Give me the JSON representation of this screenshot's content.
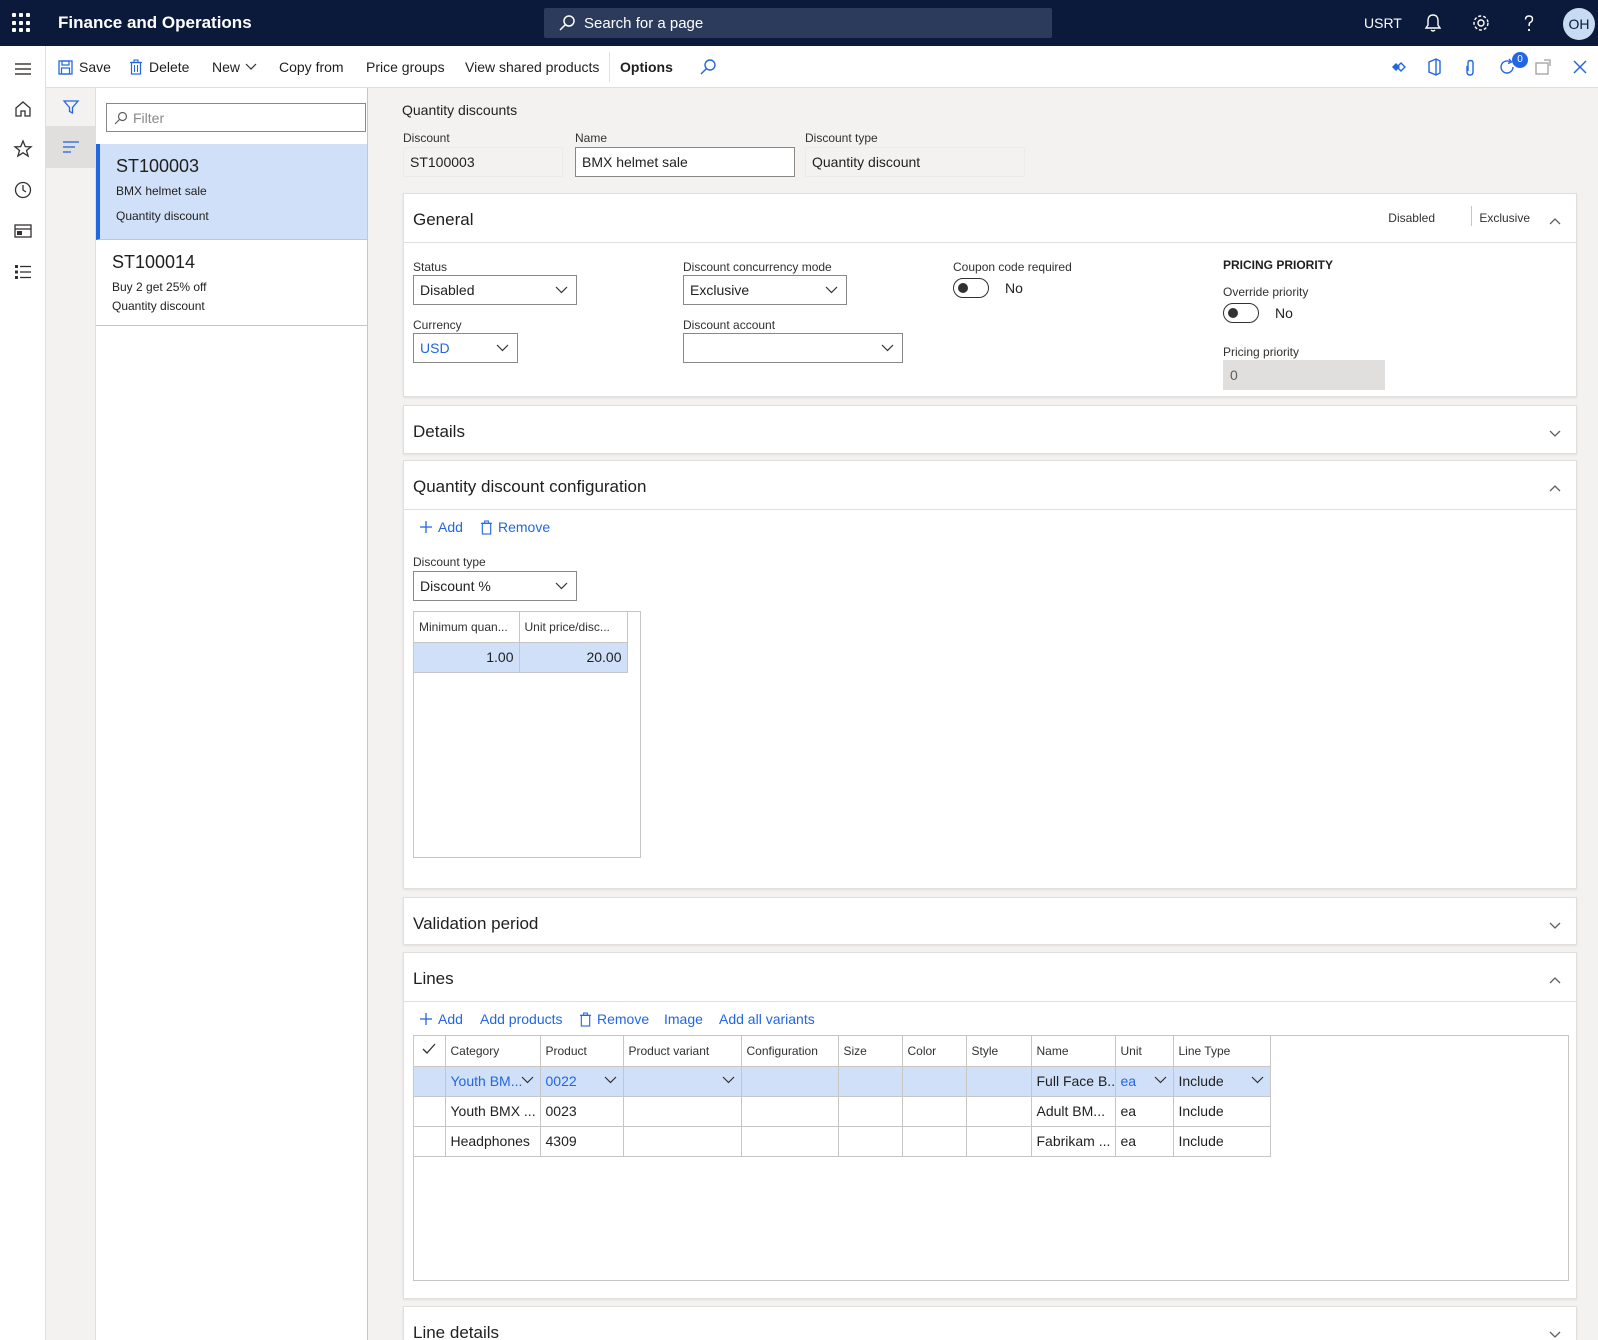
{
  "topbar": {
    "app_title": "Finance and Operations",
    "search_placeholder": "Search for a page",
    "company": "USRT",
    "avatar_initials": "OH"
  },
  "actions": {
    "save": "Save",
    "delete": "Delete",
    "new": "New",
    "copy_from": "Copy from",
    "price_groups": "Price groups",
    "view_shared_products": "View shared products",
    "options": "Options",
    "notification_count": "0"
  },
  "list": {
    "filter_placeholder": "Filter",
    "items": [
      {
        "id": "ST100003",
        "name": "BMX helmet sale",
        "type": "Quantity discount"
      },
      {
        "id": "ST100014",
        "name": "Buy 2 get 25% off",
        "type": "Quantity discount"
      }
    ]
  },
  "header": {
    "breadcrumb": "Quantity discounts",
    "discount_label": "Discount",
    "discount_value": "ST100003",
    "name_label": "Name",
    "name_value": "BMX helmet sale",
    "type_label": "Discount type",
    "type_value": "Quantity discount"
  },
  "general": {
    "title": "General",
    "summary_status": "Disabled",
    "summary_mode": "Exclusive",
    "status_label": "Status",
    "status_value": "Disabled",
    "currency_label": "Currency",
    "currency_value": "USD",
    "concurrency_label": "Discount concurrency mode",
    "concurrency_value": "Exclusive",
    "account_label": "Discount account",
    "account_value": "",
    "coupon_label": "Coupon code required",
    "coupon_value": "No",
    "pricing_caption": "PRICING PRIORITY",
    "override_label": "Override priority",
    "override_value": "No",
    "priority_label": "Pricing priority",
    "priority_value": "0"
  },
  "details": {
    "title": "Details"
  },
  "qty_config": {
    "title": "Quantity discount configuration",
    "add": "Add",
    "remove": "Remove",
    "discount_type_label": "Discount type",
    "discount_type_value": "Discount %",
    "columns": [
      "Minimum quan...",
      "Unit price/disc..."
    ],
    "rows": [
      [
        "1.00",
        "20.00"
      ]
    ]
  },
  "validation": {
    "title": "Validation period"
  },
  "lines": {
    "title": "Lines",
    "add": "Add",
    "add_products": "Add products",
    "remove": "Remove",
    "image": "Image",
    "add_all_variants": "Add all variants",
    "columns": [
      "Category",
      "Product",
      "Product variant",
      "Configuration",
      "Size",
      "Color",
      "Style",
      "Name",
      "Unit",
      "Line Type"
    ],
    "rows": [
      [
        "Youth BM...",
        "0022",
        "",
        "",
        "",
        "",
        "",
        "Full Face B...",
        "ea",
        "Include"
      ],
      [
        "Youth BMX ...",
        "0023",
        "",
        "",
        "",
        "",
        "",
        "Adult BM...",
        "ea",
        "Include"
      ],
      [
        "Headphones",
        "4309",
        "",
        "",
        "",
        "",
        "",
        "Fabrikam ...",
        "ea",
        "Include"
      ]
    ]
  },
  "line_details": {
    "title": "Line details"
  },
  "colors": {
    "topbar": "#0b1a3a",
    "accent": "#2266e3",
    "selected": "#cfe0f8"
  }
}
